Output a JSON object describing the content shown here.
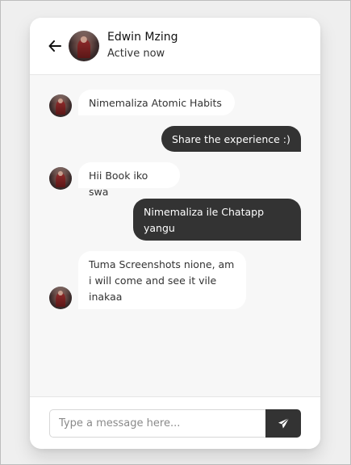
{
  "chat": {
    "contact_name": "Edwin Mzing",
    "status": "Active now",
    "messages": [
      {
        "direction": "incoming",
        "text": "Nimemaliza Atomic Habits"
      },
      {
        "direction": "outgoing",
        "text": "Share the experience :)"
      },
      {
        "direction": "incoming",
        "text": "Hii Book iko swa"
      },
      {
        "direction": "outgoing",
        "text": "Nimemaliza ile Chatapp yangu"
      },
      {
        "direction": "incoming",
        "text": "Tuma Screenshots nione, am i will come and see it vile inakaa"
      }
    ]
  },
  "composer": {
    "placeholder": "Type a message here..."
  },
  "icons": {
    "back": "arrow-left-icon",
    "send": "paper-plane-icon"
  },
  "colors": {
    "outgoing_bubble": "#333333",
    "incoming_bubble": "#ffffff",
    "send_button": "#333333"
  }
}
